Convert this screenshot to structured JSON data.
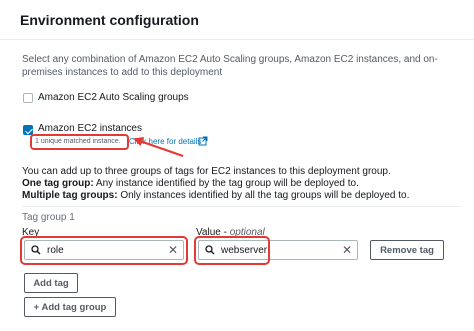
{
  "panel": {
    "title": "Environment configuration",
    "description": "Select any combination of Amazon EC2 Auto Scaling groups, Amazon EC2 instances, and on-premises instances to add to this deployment"
  },
  "options": {
    "asg_label": "Amazon EC2 Auto Scaling groups",
    "asg_checked": false,
    "ec2_label": "Amazon EC2 instances",
    "ec2_checked": true,
    "matched_text": "1 unique matched instance.",
    "details_link": "Click here for details"
  },
  "info": {
    "line1": "You can add up to three groups of tags for EC2 instances to this deployment group.",
    "one_tag_bold": "One tag group:",
    "one_tag_text": " Any instance identified by the tag group will be deployed to.",
    "multi_tag_bold": "Multiple tag groups:",
    "multi_tag_text": " Only instances identified by all the tag groups will be deployed to."
  },
  "tag_group": {
    "label": "Tag group 1",
    "key_label": "Key",
    "value_label": "Value - ",
    "value_optional": "optional",
    "key_value": "role",
    "value_value": "webserver",
    "remove_button": "Remove tag",
    "add_tag_button": "Add tag",
    "add_group_button": "+ Add tag group"
  },
  "colors": {
    "annotation": "#e53935",
    "link": "#0073bb",
    "checkbox_checked": "#0073bb"
  },
  "icons": [
    "external-link-icon",
    "search-icon",
    "clear-icon",
    "arrow-annotation"
  ]
}
